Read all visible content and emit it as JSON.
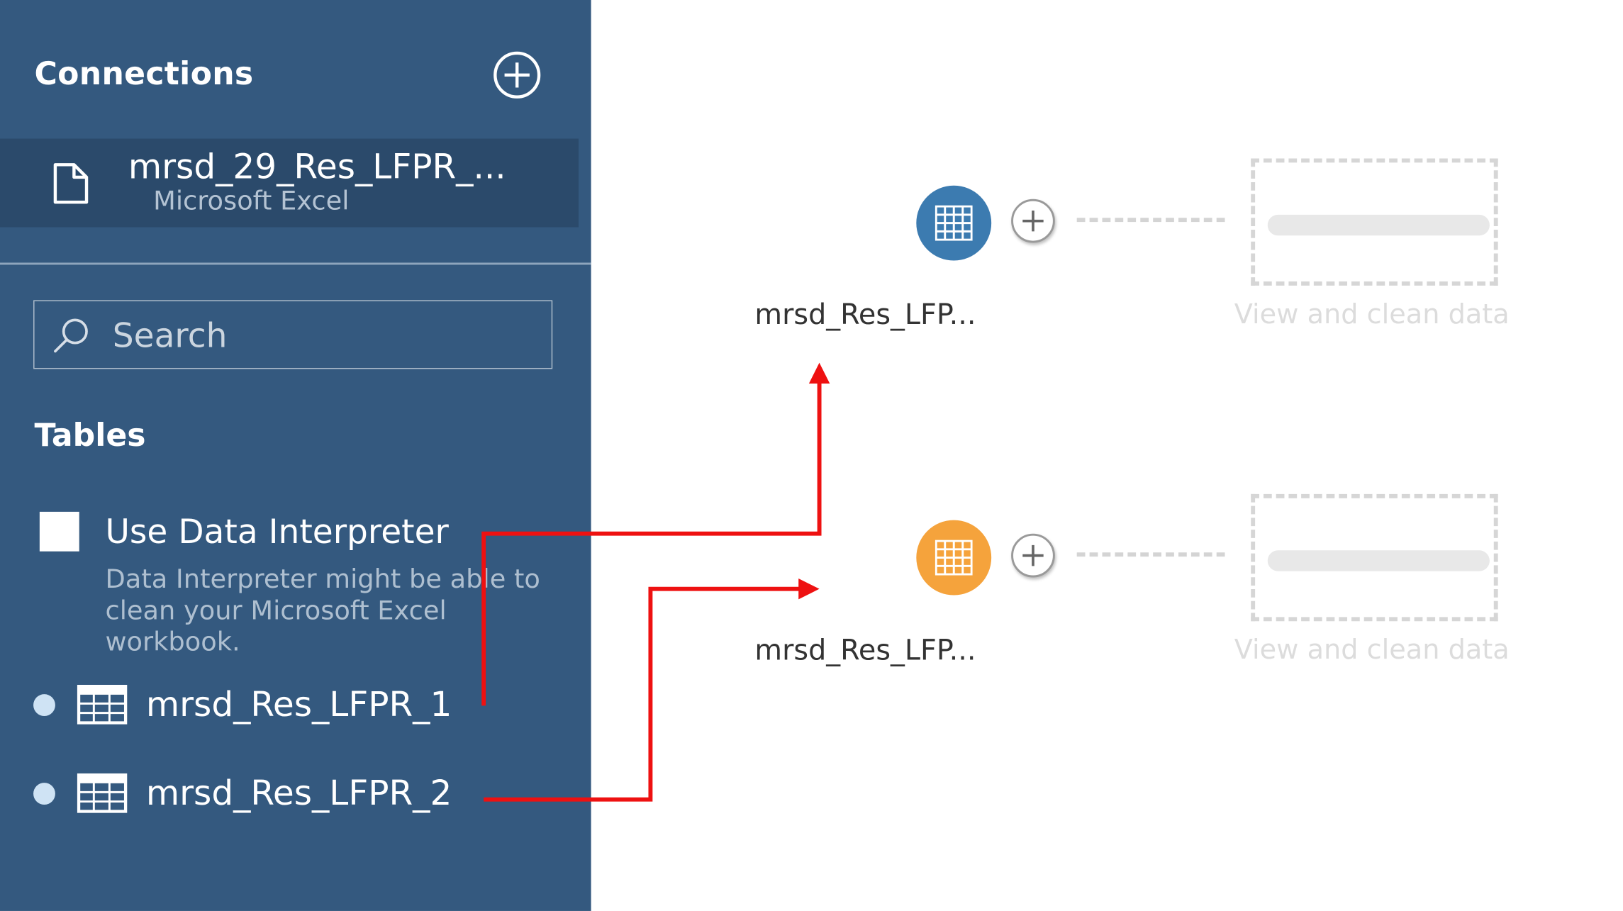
{
  "sidebar": {
    "connections_title": "Connections",
    "connection": {
      "name": "mrsd_29_Res_LFPR_...",
      "type": "Microsoft Excel",
      "icon": "file-icon"
    },
    "search": {
      "placeholder": "Search",
      "value": ""
    },
    "tables_title": "Tables",
    "data_interpreter": {
      "label": "Use Data Interpreter",
      "hint": "Data Interpreter might be able to clean your Microsoft Excel workbook.",
      "checked": false
    },
    "tables": [
      {
        "label": "mrsd_Res_LFPR_1",
        "icon": "table-grid-icon"
      },
      {
        "label": "mrsd_Res_LFPR_2",
        "icon": "table-grid-icon"
      }
    ]
  },
  "canvas": {
    "nodes": [
      {
        "label": "mrsd_Res_LFP...",
        "color": "#3c7bb0",
        "placeholder": "View and clean data"
      },
      {
        "label": "mrsd_Res_LFP...",
        "color": "#f5a33c",
        "placeholder": "View and clean data"
      }
    ]
  },
  "colors": {
    "sidebar_bg": "#34597f",
    "selected_connection_bg": "#2b4a6b",
    "annotation_arrow": "#ee1111"
  }
}
